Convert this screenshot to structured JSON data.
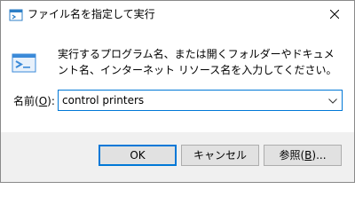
{
  "window": {
    "title": "ファイル名を指定して実行",
    "icon": "run-icon",
    "close_icon": "close-icon"
  },
  "main": {
    "description": "実行するプログラム名、または開くフォルダーやドキュメント名、インターネット リソース名を入力してください。",
    "open_label_prefix": "名前(",
    "open_label_accel": "O",
    "open_label_suffix": "):",
    "open_value": "control printers"
  },
  "buttons": {
    "ok": "OK",
    "cancel": "キャンセル",
    "browse_prefix": "参照(",
    "browse_accel": "B",
    "browse_suffix": ")..."
  },
  "colors": {
    "accent": "#0078d7",
    "window_bg": "#f0f0f0",
    "button_bg": "#e1e1e1"
  }
}
